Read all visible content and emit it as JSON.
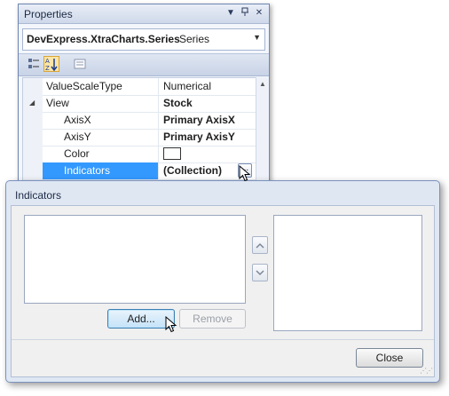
{
  "properties": {
    "title": "Properties",
    "object_name": "DevExpress.XtraCharts.Series",
    "object_type": "Series",
    "rows": [
      {
        "name": "ValueScaleType",
        "value": "Numerical",
        "bold": false
      },
      {
        "name": "View",
        "value": "Stock",
        "bold": true
      },
      {
        "name": "AxisX",
        "value": "Primary AxisX",
        "bold": true
      },
      {
        "name": "AxisY",
        "value": "Primary AxisY",
        "bold": true
      },
      {
        "name": "Color",
        "value": "",
        "bold": false
      },
      {
        "name": "Indicators",
        "value": "(Collection)",
        "bold": true
      }
    ],
    "ellipsis": "..."
  },
  "dialog": {
    "title": "Indicators",
    "add_label": "Add...",
    "remove_label": "Remove",
    "close_label": "Close"
  }
}
